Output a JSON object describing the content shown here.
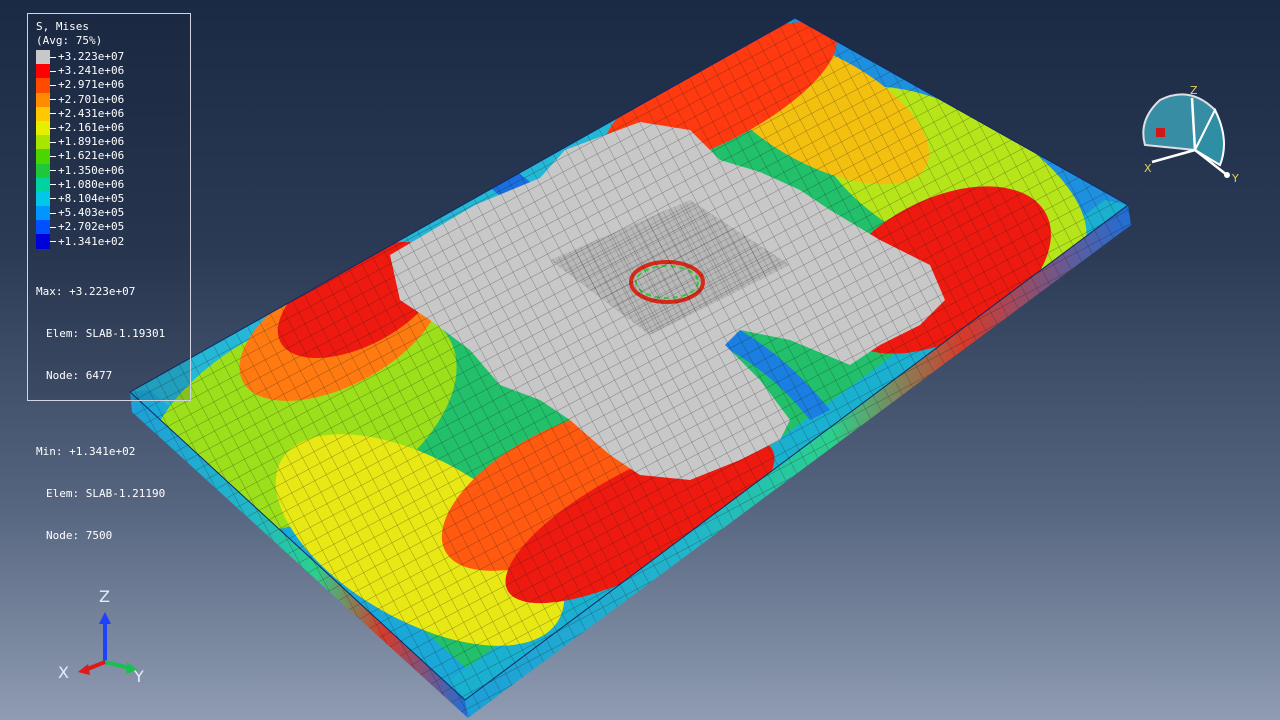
{
  "legend": {
    "title": "S, Mises",
    "subtitle": "(Avg: 75%)",
    "levels": [
      {
        "label": "+3.223e+07",
        "color": "#c8c8c8"
      },
      {
        "label": "+3.241e+06",
        "color": "#ff0000"
      },
      {
        "label": "+2.971e+06",
        "color": "#ff4a00"
      },
      {
        "label": "+2.701e+06",
        "color": "#ff8c00"
      },
      {
        "label": "+2.431e+06",
        "color": "#ffc800"
      },
      {
        "label": "+2.161e+06",
        "color": "#e6ef00"
      },
      {
        "label": "+1.891e+06",
        "color": "#a8e600"
      },
      {
        "label": "+1.621e+06",
        "color": "#4cd600"
      },
      {
        "label": "+1.350e+06",
        "color": "#1ec83a"
      },
      {
        "label": "+1.080e+06",
        "color": "#00d2a0"
      },
      {
        "label": "+8.104e+05",
        "color": "#00c8e6"
      },
      {
        "label": "+5.403e+05",
        "color": "#0096ff"
      },
      {
        "label": "+2.702e+05",
        "color": "#0050ff"
      },
      {
        "label": "+1.341e+02",
        "color": "#0000d8"
      }
    ],
    "max_label": "Max: +3.223e+07",
    "max_elem": "Elem: SLAB-1.19301",
    "max_node": "Node: 6477",
    "min_label": "Min: +1.341e+02",
    "min_elem": "Elem: SLAB-1.21190",
    "min_node": "Node: 7500"
  },
  "triad": {
    "x": "X",
    "y": "Y",
    "z": "Z"
  },
  "view_cube": {
    "x": "X",
    "y": "Y",
    "z": "Z"
  },
  "colors": {
    "background_top": "#1b2a44",
    "background_bottom": "#8f9cb2",
    "mesh_line": "#1a1a1a",
    "gray_region": "#c8c8c8"
  }
}
